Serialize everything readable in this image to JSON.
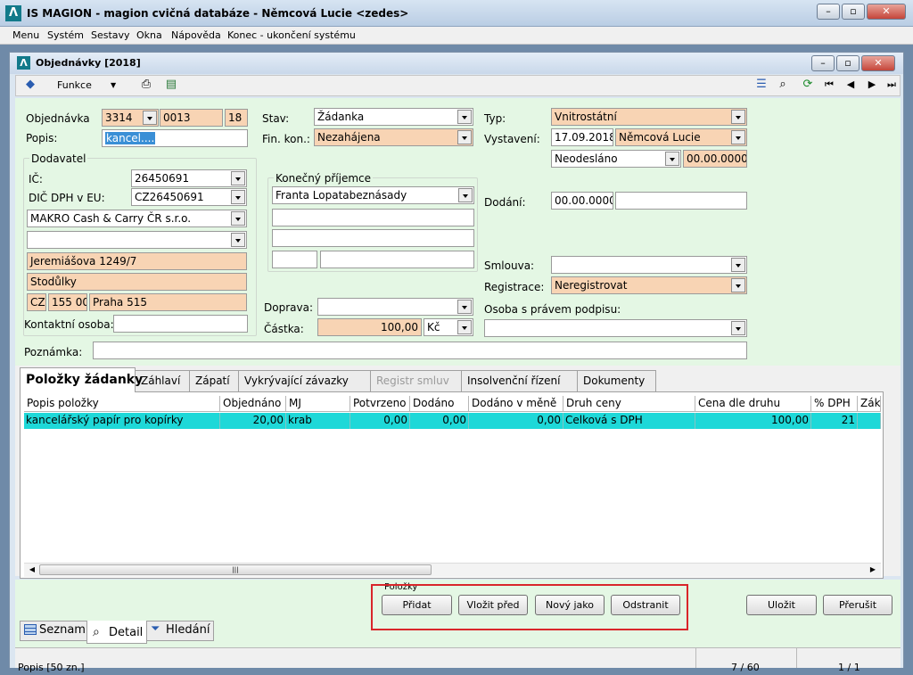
{
  "app": {
    "title": "IS MAGION - magion cvičná databáze - Němcová Lucie <zedes>",
    "minimize": "–",
    "restore": "▫",
    "close": "✕"
  },
  "menu": [
    "Menu",
    "Systém",
    "Sestavy",
    "Okna",
    "Nápověda",
    "Konec - ukončení systému"
  ],
  "window": {
    "title": "Objednávky [2018]",
    "minimize": "–",
    "restore": "▫",
    "close": "✕"
  },
  "toolbar": {
    "funkce_label": "Funkce"
  },
  "form": {
    "objednavka_label": "Objednávka",
    "obj_cislo": "3314",
    "obj_rada": "0013",
    "obj_pocet": "18",
    "popis_label": "Popis:",
    "popis_value": "kancel....",
    "dodavatel_label": "Dodavatel",
    "ic_label": "IČ:",
    "ic_value": "26450691",
    "dic_label": "DIČ DPH v EU:",
    "dic_value": "CZ26450691",
    "firma": "MAKRO Cash & Carry ČR s.r.o.",
    "firma2": "",
    "ulice": "Jeremiášova 1249/7",
    "obec": "Stodůlky",
    "stat": "CZ",
    "psc": "155 00",
    "mesto": "Praha 515",
    "kontakt_label": "Kontaktní osoba:",
    "kontakt_value": "",
    "stav_label": "Stav:",
    "stav_value": "Žádanka",
    "finkon_label": "Fin. kon.:",
    "finkon_value": "Nezahájena",
    "prijemce_label": "Konečný příjemce",
    "prijemce_value": "Franta Lopatabeznásady",
    "doprava_label": "Doprava:",
    "doprava_value": "",
    "castka_label": "Částka:",
    "castka_value": "100,00",
    "mena": "Kč",
    "typ_label": "Typ:",
    "typ_value": "Vnitrostátní",
    "vystaveni_label": "Vystavení:",
    "vystaveni_datum": "17.09.2018",
    "vystavil": "Němcová Lucie",
    "odeslani": "Neodesláno",
    "odeslani_datum": "00.00.0000",
    "dodani_label": "Dodání:",
    "dodani_datum": "00.00.0000",
    "dodani_text": "",
    "smlouva_label": "Smlouva:",
    "smlouva_value": "",
    "registrace_label": "Registrace:",
    "registrace_value": "Neregistrovat",
    "osoba_label": "Osoba s právem podpisu:",
    "osoba_value": "",
    "poznamka_label": "Poznámka:",
    "poznamka_value": ""
  },
  "tabs": [
    "Položky žádanky",
    "Záhlaví",
    "Zápatí",
    "Vykrývající závazky",
    "Registr smluv",
    "Insolvenční řízení",
    "Dokumenty"
  ],
  "table": {
    "columns": [
      "Popis položky",
      "Objednáno",
      "MJ",
      "Potvrzeno",
      "Dodáno",
      "Dodáno v měně",
      "Druh ceny",
      "Cena dle druhu",
      "% DPH",
      "Zák"
    ],
    "rows": [
      [
        "kancelářský papír pro kopírky",
        "20,00",
        "krab",
        "0,00",
        "0,00",
        "0,00",
        "Celková s DPH",
        "100,00",
        "21",
        ""
      ]
    ]
  },
  "polozky": {
    "group_label": "Položky",
    "pridat": "Přidat",
    "vlozit_pred": "Vložit před",
    "novy_jako": "Nový jako",
    "odstranit": "Odstranit"
  },
  "actions": {
    "ulozit": "Uložit",
    "prerusit": "Přerušit"
  },
  "bottom_tabs": {
    "seznam": "Seznam",
    "detail": "Detail",
    "hledani": "Hledání"
  },
  "statusbar": {
    "left": "Popis [50 zn.]",
    "mid": "7 / 60",
    "right": "1 / 1"
  },
  "colors": {
    "form_bg": "#e4f7e4",
    "selection": "#1ed8d8",
    "highlight_box": "#d9262a",
    "orange_field": "#f8d4b4"
  }
}
